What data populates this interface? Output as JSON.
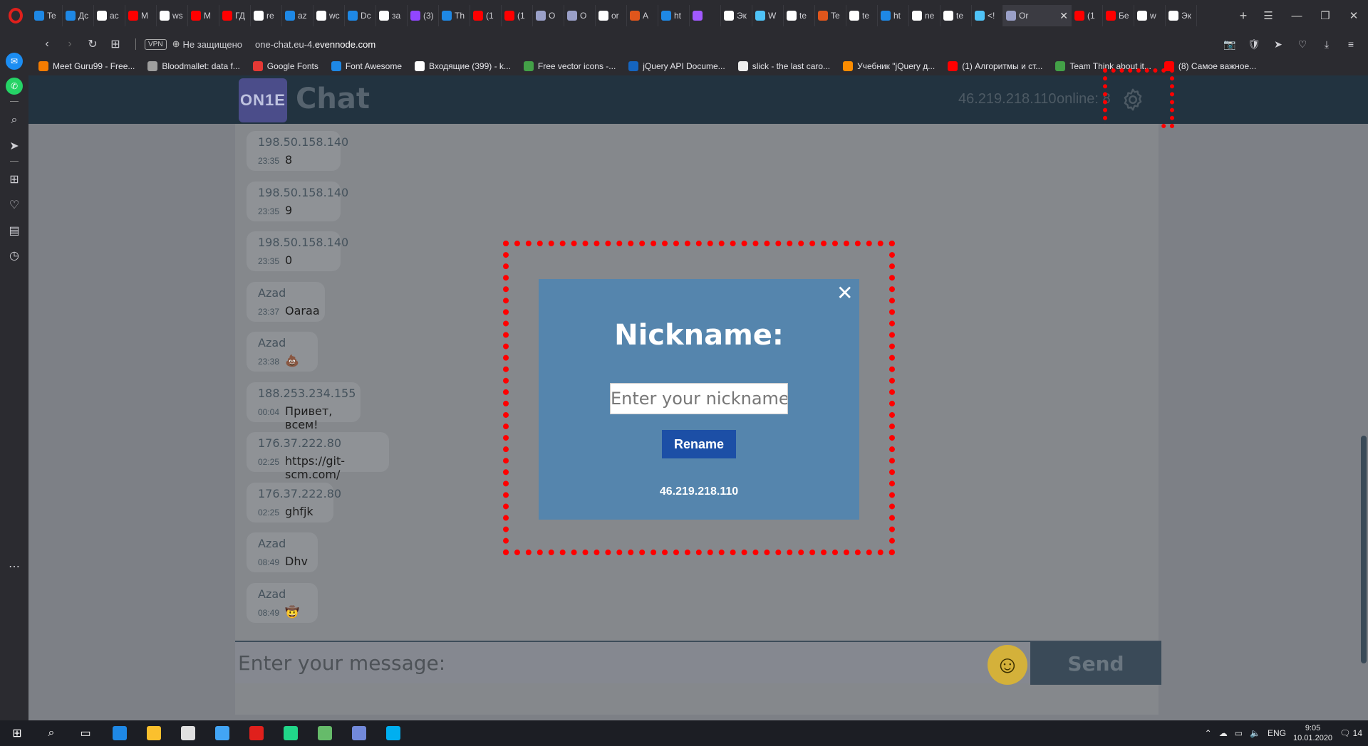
{
  "browser": {
    "tabs": [
      {
        "label": "Te",
        "color": "#1e88e5"
      },
      {
        "label": "Дс",
        "color": "#1e88e5"
      },
      {
        "label": "ac",
        "color": "#ffffff"
      },
      {
        "label": "M",
        "color": "#ff0000"
      },
      {
        "label": "ws",
        "color": "#ffffff"
      },
      {
        "label": "M",
        "color": "#ff0000"
      },
      {
        "label": "ГД",
        "color": "#ff0000"
      },
      {
        "label": "re",
        "color": "#ffffff"
      },
      {
        "label": "az",
        "color": "#1e88e5"
      },
      {
        "label": "wc",
        "color": "#ffffff"
      },
      {
        "label": "Dc",
        "color": "#1e88e5"
      },
      {
        "label": "за",
        "color": "#ffffff"
      },
      {
        "label": "(3)",
        "color": "#9146ff"
      },
      {
        "label": "Th",
        "color": "#1e88e5"
      },
      {
        "label": "(1",
        "color": "#ff0000"
      },
      {
        "label": "(1",
        "color": "#ff0000"
      },
      {
        "label": "O",
        "color": "#9aa0c8"
      },
      {
        "label": "O",
        "color": "#9aa0c8"
      },
      {
        "label": "or",
        "color": "#ffffff"
      },
      {
        "label": "A",
        "color": "#e0561c"
      },
      {
        "label": "ht",
        "color": "#1e88e5"
      },
      {
        "label": "",
        "color": "#a259ff"
      },
      {
        "label": "Эк",
        "color": "#ffffff"
      },
      {
        "label": "W",
        "color": "#4fc3f7"
      },
      {
        "label": "te",
        "color": "#ffffff"
      },
      {
        "label": "Te",
        "color": "#e0561c"
      },
      {
        "label": "te",
        "color": "#ffffff"
      },
      {
        "label": "ht",
        "color": "#1e88e5"
      },
      {
        "label": "ne",
        "color": "#ffffff"
      },
      {
        "label": "te",
        "color": "#ffffff"
      },
      {
        "label": "<!",
        "color": "#4fc3f7"
      }
    ],
    "active_tab": {
      "label": "Or",
      "color": "#9aa0c8",
      "close": "✕"
    },
    "tabs_after": [
      {
        "label": "(1",
        "color": "#ff0000"
      },
      {
        "label": "Бе",
        "color": "#ff0000"
      },
      {
        "label": "w",
        "color": "#ffffff"
      },
      {
        "label": "Эк",
        "color": "#ffffff"
      }
    ],
    "new_tab": "+",
    "window_controls": {
      "menu": "☰",
      "minimize": "—",
      "restore": "❐",
      "close": "✕"
    },
    "address": {
      "back": "‹",
      "forward": "›",
      "reload": "↻",
      "grid": "⊞",
      "vpn": "VPN",
      "security_text": "Не защищено",
      "url_prefix": "one-chat.eu-4.",
      "url_domain": "evennode.com",
      "right_icons": [
        "📷",
        "🛡",
        "➤",
        "♡",
        "⤓",
        "≡"
      ]
    },
    "bookmarks": [
      {
        "label": "Meet Guru99 - Free...",
        "color": "#f57c00"
      },
      {
        "label": "Bloodmallet: data f...",
        "color": "#9e9e9e"
      },
      {
        "label": "Google Fonts",
        "color": "#e53935"
      },
      {
        "label": "Font Awesome",
        "color": "#1e88e5"
      },
      {
        "label": "Входящие (399) - k...",
        "color": "#ffffff"
      },
      {
        "label": "Free vector icons -...",
        "color": "#43a047"
      },
      {
        "label": "jQuery API Docume...",
        "color": "#1565c0"
      },
      {
        "label": "slick - the last caro...",
        "color": "#eeeeee"
      },
      {
        "label": "Учебник \"jQuery д...",
        "color": "#fb8c00"
      },
      {
        "label": "(1) Алгоритмы и ст...",
        "color": "#ff0000"
      },
      {
        "label": "Team Think about it...",
        "color": "#43a047"
      },
      {
        "label": "(8) Самое важное...",
        "color": "#ff0000"
      }
    ]
  },
  "sidebar": {
    "items": [
      {
        "name": "messenger-icon",
        "glyph": "✉"
      },
      {
        "name": "whatsapp-icon",
        "glyph": "✆"
      },
      {
        "name": "search-icon",
        "glyph": "⌕"
      },
      {
        "name": "send-icon",
        "glyph": "➤"
      },
      {
        "name": "speed-dial-icon",
        "glyph": "⊞"
      },
      {
        "name": "heart-icon",
        "glyph": "♡"
      },
      {
        "name": "news-icon",
        "glyph": "▤"
      },
      {
        "name": "history-icon",
        "glyph": "◷"
      }
    ],
    "more": "⋯"
  },
  "chat": {
    "logo_text": "ON1E",
    "title": "Chat",
    "header_ip": "46.219.218.110",
    "online_text": "online: 8",
    "messages": [
      {
        "author": "198.50.158.140",
        "time": "23:35",
        "text": "8"
      },
      {
        "author": "198.50.158.140",
        "time": "23:35",
        "text": "9"
      },
      {
        "author": "198.50.158.140",
        "time": "23:35",
        "text": "0"
      },
      {
        "author": "Azad",
        "time": "23:37",
        "text": "Oaraa"
      },
      {
        "author": "Azad",
        "time": "23:38",
        "text": "💩"
      },
      {
        "author": "188.253.234.155",
        "time": "00:04",
        "text": "Привет, всем!"
      },
      {
        "author": "176.37.222.80",
        "time": "02:25",
        "text": "https://git-scm.com/"
      },
      {
        "author": "176.37.222.80",
        "time": "02:25",
        "text": "ghfjk"
      },
      {
        "author": "Azad",
        "time": "08:49",
        "text": "Dhv"
      },
      {
        "author": "Azad",
        "time": "08:49",
        "text": "🤠"
      }
    ],
    "message_placeholder": "Enter your message:",
    "emoji_glyph": "☺",
    "send_label": "Send"
  },
  "modal": {
    "close": "✕",
    "title": "Nickname:",
    "nickname_placeholder": "Enter your nickname",
    "rename_label": "Rename",
    "ip": "46.219.218.110"
  },
  "taskbar": {
    "start": "⊞",
    "search": "⌕",
    "task_view": "▭",
    "apps": [
      {
        "name": "edge-app",
        "color": "#1e88e5"
      },
      {
        "name": "explorer-app",
        "color": "#fbc02d"
      },
      {
        "name": "mail-app",
        "color": "#e0e0e0"
      },
      {
        "name": "store-app",
        "color": "#42a5f5"
      },
      {
        "name": "opera-app",
        "color": "#e0201c"
      },
      {
        "name": "webstorm-app",
        "color": "#21d789"
      },
      {
        "name": "xmind-app",
        "color": "#66bb6a"
      },
      {
        "name": "discord-app",
        "color": "#7289da"
      },
      {
        "name": "skype-app",
        "color": "#00aff0"
      }
    ],
    "language": "ENG",
    "time": "9:05",
    "date": "10.01.2020",
    "notifications": "14"
  }
}
